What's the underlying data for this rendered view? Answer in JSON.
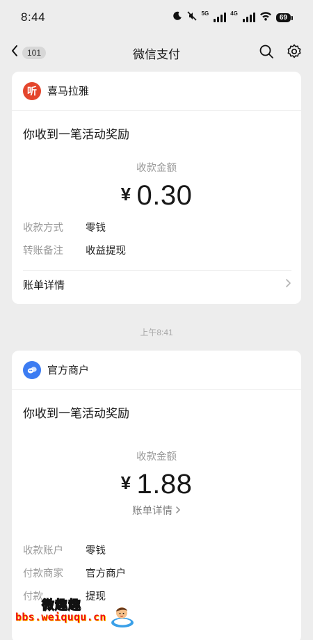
{
  "statusbar": {
    "time": "8:44",
    "net1": "5G",
    "net2": "4G",
    "battery": "69"
  },
  "navbar": {
    "title": "微信支付",
    "back_badge": "101"
  },
  "card1": {
    "merchant": "喜马拉雅",
    "title": "你收到一笔活动奖励",
    "amount_label": "收款金额",
    "currency": "¥",
    "amount": "0.30",
    "rows": [
      {
        "key": "收款方式",
        "value": "零钱"
      },
      {
        "key": "转账备注",
        "value": "收益提现"
      }
    ],
    "detail_link": "账单详情"
  },
  "timestamp": "上午8:41",
  "card2": {
    "merchant": "官方商户",
    "title": "你收到一笔活动奖励",
    "amount_label": "收款金额",
    "currency": "¥",
    "amount": "1.88",
    "detail_link": "账单详情",
    "rows": [
      {
        "key": "收款账户",
        "value": "零钱"
      },
      {
        "key": "付款商家",
        "value": "官方商户"
      },
      {
        "key": "付款…",
        "value": "提现"
      }
    ]
  },
  "watermark": {
    "title": "微趣趣",
    "url": "bbs.weiququ.cn"
  },
  "colors": {
    "background": "#ededed",
    "card": "#ffffff",
    "ximalaya_brand": "#e4462d",
    "official_brand": "#3c7cf2",
    "watermark_url": "#ee1111"
  }
}
